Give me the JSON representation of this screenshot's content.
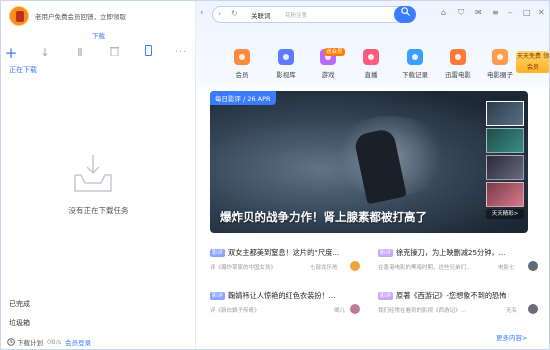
{
  "sidebar": {
    "promo_text": "老用户免费会员回馈，立即领取",
    "title": "下载",
    "toolbar": [
      {
        "name": "add-icon",
        "glyph": "+"
      },
      {
        "name": "download-icon",
        "glyph": "↓"
      },
      {
        "name": "pause-icon",
        "glyph": "Ⅱ"
      },
      {
        "name": "trash-icon",
        "glyph": "🗑"
      },
      {
        "name": "phone-icon",
        "glyph": "▯"
      },
      {
        "name": "more-icon",
        "glyph": "···"
      }
    ],
    "active_tab": "正在下载",
    "empty_text": "没有正在下载任务",
    "categories": [
      "已完成",
      "垃圾箱"
    ],
    "status": {
      "plan": "下载计划",
      "speed": "0B/s",
      "vip": "会员登录"
    }
  },
  "browser": {
    "search_label": "关联词",
    "search_hint": "花粉注意",
    "nav_icons": [
      "back-arrow-icon",
      "forward-arrow-icon",
      "refresh-icon"
    ],
    "window_icons": [
      "skin-icon",
      "cloth-icon",
      "message-icon",
      "menu-icon",
      "minimize-icon",
      "maximize-icon",
      "close-icon"
    ]
  },
  "categories": [
    {
      "label": "会员",
      "color": "#ff8a3d"
    },
    {
      "label": "影视库",
      "color": "#5b7cff"
    },
    {
      "label": "游戏",
      "color": "#b86bff",
      "badge": "送会员"
    },
    {
      "label": "直播",
      "color": "#ff5b7d"
    },
    {
      "label": "下载记录",
      "color": "#3aa0ff"
    },
    {
      "label": "迅雷电影",
      "color": "#ff7a3a"
    },
    {
      "label": "电影圈子",
      "color": "#ff9b4a"
    }
  ],
  "gift_text": "天天免费 领会员",
  "hero": {
    "badge": "每日影评 / 26 APR",
    "title": "爆炸贝的战争力作！肾上腺素都被打高了",
    "more": "天天精彩>"
  },
  "news": [
    {
      "tag": "影评",
      "title": "双女主都美到窒息！这片的“尺度...",
      "meta": "评《爆炸掌家的中国女孩》",
      "source": "七部龙乐地",
      "avatar_color": "#f2a33a"
    },
    {
      "tag": "影评",
      "title": "徐克操刀，为上映删减25分钟，...",
      "meta": "在香港电影的黑暗时期，这些兄弟们...",
      "source": "电影七",
      "avatar_color": "#5e6b7a"
    },
    {
      "tag": "影评",
      "title": "鞠婧祎让人惊艳的红色衣装扮！...",
      "meta": "评《新白娘子传奇》",
      "source": "卿儿",
      "avatar_color": "#c07a9e"
    },
    {
      "tag": "影评",
      "title": "原著《西游记》-您想象不到的恐怖",
      "meta": "我们经常在看到的影视《西游记》...",
      "source": "无名",
      "avatar_color": "#666e77"
    }
  ],
  "more_content": "更多内容>"
}
